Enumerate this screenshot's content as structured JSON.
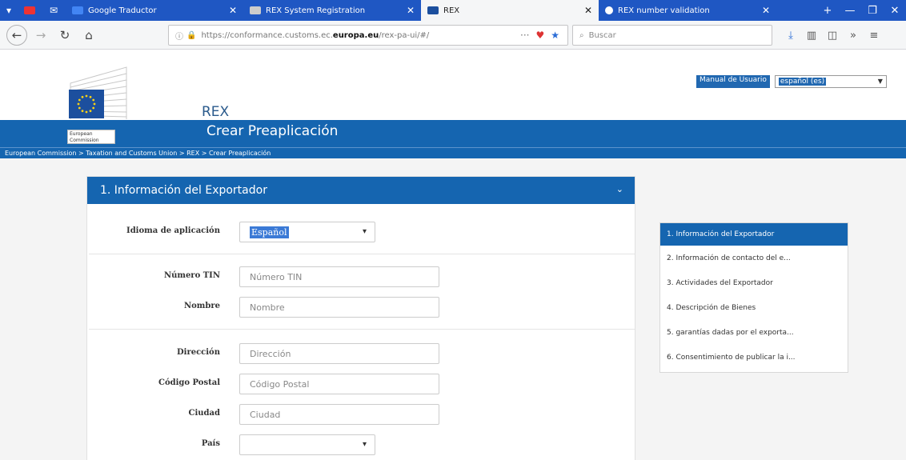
{
  "browser": {
    "tabs": [
      {
        "label": "Google Traductor",
        "icon": "translate-icon",
        "color": "#4285f4"
      },
      {
        "label": "REX System Registration",
        "icon": "page-icon",
        "color": "#cccccc"
      },
      {
        "label": "REX",
        "icon": "eu-flag-icon",
        "color": "#1c4f9e"
      },
      {
        "label": "REX number validation",
        "icon": "globe-icon",
        "color": "#ffffff"
      }
    ],
    "url_prefix": "https://conformance.customs.ec.",
    "url_host": "europa.eu",
    "url_suffix": "/rex-pa-ui/#/",
    "search_placeholder": "Buscar"
  },
  "header": {
    "app_name": "REX",
    "ec_label": "European Commission",
    "manual_link": "Manual de Usuario",
    "language_value": "español (es)",
    "page_title": "Crear Preaplicación",
    "breadcrumb": "European Commission > Taxation and Customs Union > REX > Crear Preaplicación"
  },
  "form": {
    "section_title": "1. Información del Exportador",
    "fields": [
      {
        "label": "Idioma de aplicación",
        "value": "Español"
      },
      {
        "label": "Número TIN",
        "placeholder": "Número TIN"
      },
      {
        "label": "Nombre",
        "placeholder": "Nombre"
      },
      {
        "label": "Dirección",
        "placeholder": "Dirección"
      },
      {
        "label": "Código Postal",
        "placeholder": "Código Postal"
      },
      {
        "label": "Ciudad",
        "placeholder": "Ciudad"
      },
      {
        "label": "País",
        "value": ""
      }
    ]
  },
  "sidenav": {
    "items": [
      {
        "label": "1. Información del Exportador"
      },
      {
        "label": "2. Información de contacto del e..."
      },
      {
        "label": "3. Actividades del Exportador"
      },
      {
        "label": "4. Descripción de Bienes"
      },
      {
        "label": "5. garantías dadas por el exporta..."
      },
      {
        "label": "6. Consentimiento de publicar la i..."
      }
    ]
  },
  "colors": {
    "primary": "#1565b0",
    "tabbar": "#1f57c3"
  }
}
